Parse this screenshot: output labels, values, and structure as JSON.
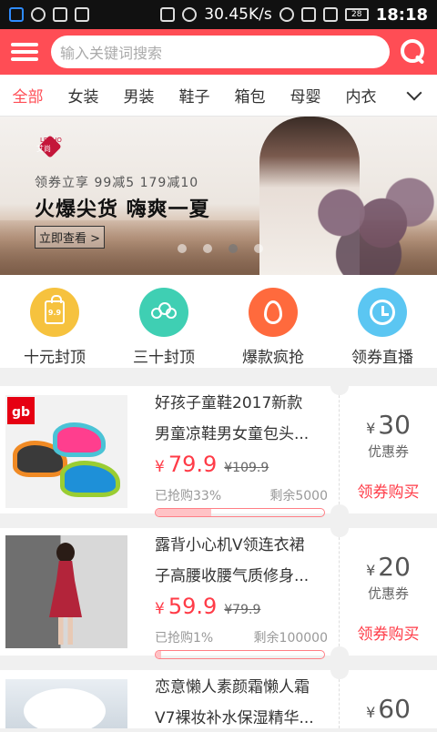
{
  "status_bar": {
    "speed": "30.45K/s",
    "battery": "28",
    "time": "18:18"
  },
  "header": {
    "search_placeholder": "输入关键词搜索"
  },
  "tabs": [
    "全部",
    "女装",
    "男装",
    "鞋子",
    "箱包",
    "母婴",
    "内衣"
  ],
  "banner": {
    "brand_name": "艾尚",
    "brand_small": "LEZHO",
    "coupon_text": "领券立享 99减5 179减10",
    "title": "火爆尖货 嗨爽一夏",
    "cta": "立即查看 >",
    "dots_count": 4,
    "active_dot": 3
  },
  "categories": [
    {
      "label": "十元封顶",
      "icon": "bag-9.9-icon",
      "color": "#f6c23e",
      "icon_text": "9.9"
    },
    {
      "label": "三十封顶",
      "icon": "users-icon",
      "color": "#3fcfb3"
    },
    {
      "label": "爆款疯抢",
      "icon": "flame-icon",
      "color": "#ff6a3d"
    },
    {
      "label": "领券直播",
      "icon": "alarm-clock-icon",
      "color": "#5bc6f2"
    }
  ],
  "products": [
    {
      "title_line1": "好孩子童鞋2017新款",
      "title_line2": "男童凉鞋男女童包头...",
      "price_symbol": "¥",
      "price": "79.9",
      "original_price": "¥109.9",
      "sold": "已抢购33%",
      "sold_fraction": 0.33,
      "remaining": "剩余5000",
      "coupon_symbol": "¥",
      "coupon_amount": "30",
      "coupon_label": "优惠券",
      "buy_label": "领券购买",
      "brand_logo": "gb"
    },
    {
      "title_line1": "露背小心机V领连衣裙",
      "title_line2": "子高腰收腰气质修身...",
      "price_symbol": "¥",
      "price": "59.9",
      "original_price": "¥79.9",
      "sold": "已抢购1%",
      "sold_fraction": 0.01,
      "remaining": "剩余100000",
      "coupon_symbol": "¥",
      "coupon_amount": "20",
      "coupon_label": "优惠券",
      "buy_label": "领券购买"
    },
    {
      "title_line1": "恋意懒人素颜霜懒人霜",
      "title_line2": "V7裸妆补水保湿精华...",
      "coupon_symbol": "¥",
      "coupon_amount": "60"
    }
  ]
}
